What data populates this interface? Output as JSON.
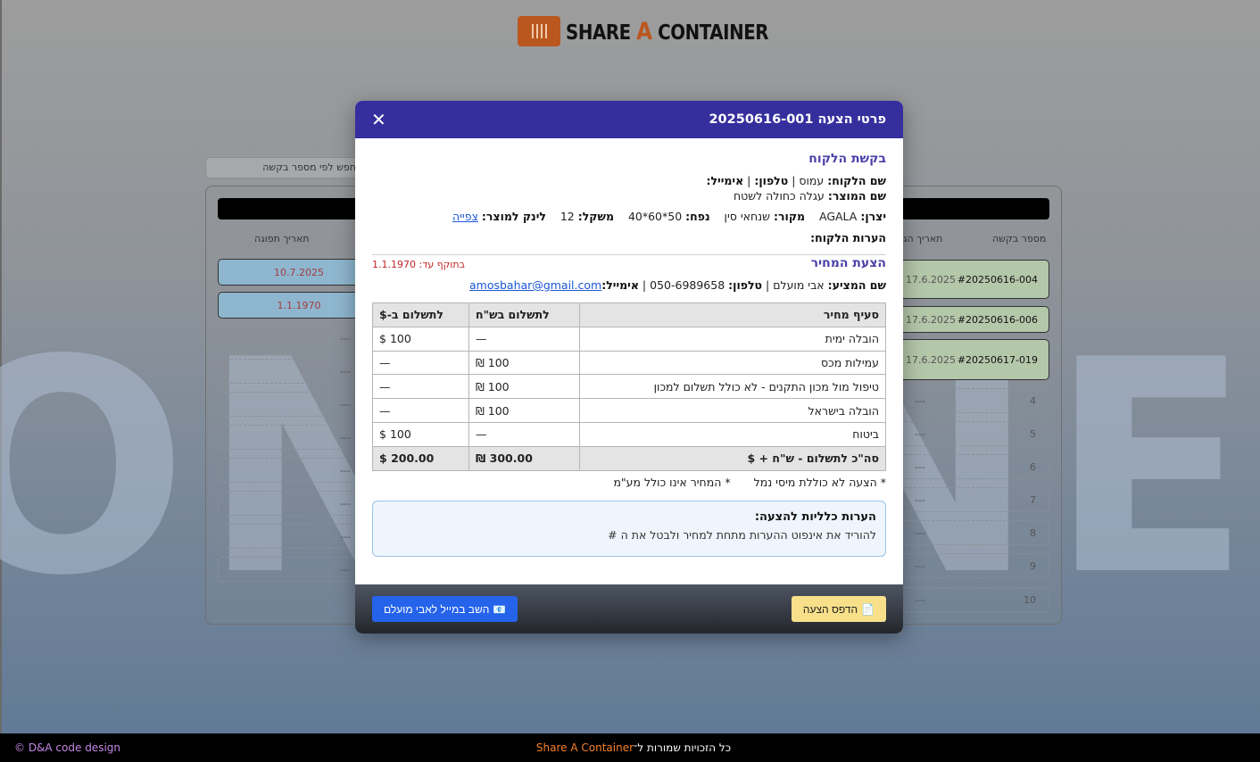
{
  "brand": {
    "logo_text_1": "SHARE ",
    "logo_text_a": "A",
    "logo_text_2": " CONTAINER",
    "accent": "#b9571f"
  },
  "background": {
    "watermark": "ONLINE",
    "search_placeholder": "חפש לפי מספר בקשה",
    "left_header": "תאריך תפוגה",
    "right_header_req": "מספר בקשה",
    "right_header_date": "תאריך הג",
    "expiry_dates": [
      "10.7.2025",
      "1.1.1970"
    ],
    "empty_placeholder": "---",
    "requests": [
      {
        "id": "#20250616-004",
        "date": "17.6.2025"
      },
      {
        "id": "#20250616-006",
        "date": "17.6.2025"
      },
      {
        "id": "#20250617-019",
        "date": "17.6.2025"
      }
    ],
    "slot_numbers": [
      "4",
      "5",
      "6",
      "7",
      "8",
      "9",
      "10"
    ]
  },
  "modal": {
    "title": "פרטי הצעה 20250616-001",
    "close_icon": "close-icon",
    "request_section": {
      "title": "בקשת הלקוח",
      "customer_label": "שם הלקוח:",
      "customer_name": "עמוס",
      "phone_label": "טלפון:",
      "phone_value": "",
      "email_label": "אימייל:",
      "email_value": "",
      "product_label": "שם המוצר:",
      "product_value": "עגלה כחולה לשטח",
      "maker_label": "יצרן:",
      "maker_value": "AGALA",
      "origin_label": "מקור:",
      "origin_value": "שנחאי סין",
      "volume_label": "נפח:",
      "volume_value": "50*60*40",
      "weight_label": "משקל:",
      "weight_value": "12",
      "link_label": "לינק למוצר:",
      "link_text": "צפייה",
      "notes_label": "הערות הלקוח:"
    },
    "offer_section": {
      "title": "הצעת המחיר",
      "valid_label": "בתוקף עד:",
      "valid_value": "1.1.1970",
      "offerer_label": "שם המציע:",
      "offerer_name": "אבי מועלם",
      "phone_label": "טלפון:",
      "phone_value": "050-6989658",
      "email_label": "אימייל:",
      "email_value": "amosbahar@gmail.com"
    },
    "table": {
      "headers": [
        "סעיף מחיר",
        "לתשלום בש\"ח",
        "לתשלום ב-$"
      ],
      "rows": [
        {
          "item": "הובלה ימית",
          "ils": "—",
          "usd": "100 $"
        },
        {
          "item": "עמילות מכס",
          "ils": "100 ₪",
          "usd": "—"
        },
        {
          "item": "טיפול מול מכון התקנים - לא כולל תשלום למכון",
          "ils": "100 ₪",
          "usd": "—"
        },
        {
          "item": "הובלה בישראל",
          "ils": "100 ₪",
          "usd": "—"
        },
        {
          "item": "ביטוח",
          "ils": "—",
          "usd": "100 $"
        }
      ],
      "total": {
        "label": "סה\"כ לתשלום - ש\"ח + $",
        "ils": "300.00 ₪",
        "usd": "200.00 $"
      }
    },
    "footnote_1": "* הצעה לא כוללת מיסי נמל",
    "footnote_2": "* המחיר אינו כולל מע\"מ",
    "general_notes": {
      "title": "הערות כלליות להצעה:",
      "content": "להוריד את אינפוט ההערות מתחת למחיר ולבטל את ה #"
    },
    "buttons": {
      "print_icon": "document-icon",
      "print_label": "הדפס הצעה",
      "reply_icon": "envelope-icon",
      "reply_label": "השב במייל לאבי מועלם"
    }
  },
  "footer": {
    "copyright": "© D&A code design",
    "rights_text": "כל הזכויות שמורות ל־",
    "rights_brand": "Share A Container"
  }
}
